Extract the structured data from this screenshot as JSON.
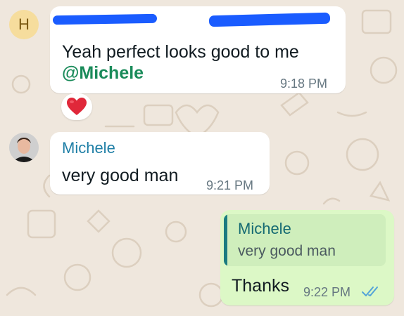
{
  "chat": {
    "message_1": {
      "avatar_initial": "H",
      "text": "Yeah perfect looks good to me",
      "mention": "@Michele",
      "time": "9:18 PM",
      "reaction_icon": "red-heart",
      "redacted_sender": true
    },
    "message_2": {
      "sender": "Michele",
      "text": "very good man",
      "time": "9:21 PM"
    },
    "message_3": {
      "quoted_sender": "Michele",
      "quoted_text": "very good man",
      "text": "Thanks",
      "time": "9:22 PM",
      "status_icon": "double-check-read"
    }
  },
  "colors": {
    "chat_background": "#efe7dd",
    "incoming_bubble": "#ffffff",
    "outgoing_bubble": "#dcf8c6",
    "mention": "#1a8b5a",
    "sender_name": "#1f7fa6",
    "read_ticks": "#53a3d8",
    "redaction": "#1a5cff"
  }
}
